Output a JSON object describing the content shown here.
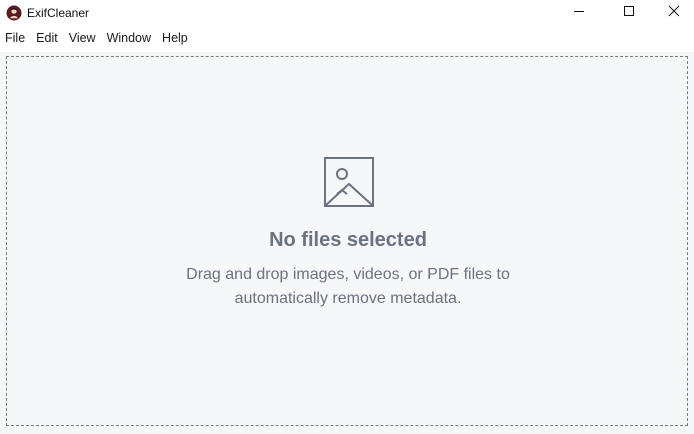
{
  "window": {
    "title": "ExifCleaner",
    "icon": "exifcleaner-logo-icon",
    "controls": {
      "minimize": "minimize-icon",
      "maximize": "maximize-icon",
      "close": "close-icon"
    }
  },
  "menu": {
    "items": [
      "File",
      "Edit",
      "View",
      "Window",
      "Help"
    ]
  },
  "dropzone": {
    "icon": "image-placeholder-icon",
    "title": "No files selected",
    "description": "Drag and drop images, videos, or PDF files to automatically remove metadata."
  },
  "colors": {
    "background": "#f6f7f9",
    "text_muted": "#6b7280",
    "border": "#7a7f86",
    "logo_bg": "#5a1c24"
  }
}
